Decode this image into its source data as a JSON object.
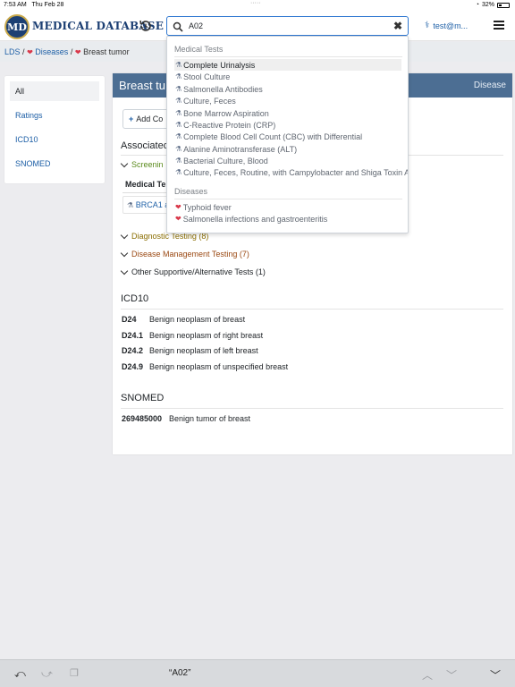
{
  "status": {
    "time": "7:53 AM",
    "date": "Thu Feb 28",
    "battery": "32%"
  },
  "brand": {
    "logo_letters": "MD",
    "name": "MEDICAL DATABASE"
  },
  "search": {
    "value": "A02"
  },
  "user": {
    "label": "test@m..."
  },
  "breadcrumb": {
    "root": "LDS",
    "sep1": "/",
    "diseases": "Diseases",
    "sep2": "/",
    "current": "Breast tumor"
  },
  "sidebar": {
    "items": [
      {
        "label": "All"
      },
      {
        "label": "Ratings"
      },
      {
        "label": "ICD10"
      },
      {
        "label": "SNOMED"
      }
    ]
  },
  "main": {
    "title": "Breast tu",
    "kind": "Disease",
    "add_button": "Add Co",
    "associated_title": "Associated",
    "screening_label": "Screenin",
    "medical_tests_header": "Medical Te",
    "brca_link": "BRCA1 a",
    "accordions": [
      {
        "label": "Diagnostic Testing (8)",
        "color": "#8a6d00"
      },
      {
        "label": "Disease Management Testing (7)",
        "color": "#9b4a14"
      },
      {
        "label": "Other Supportive/Alternative Tests (1)",
        "color": "#212529"
      }
    ],
    "icd10": {
      "title": "ICD10",
      "rows": [
        {
          "code": "D24",
          "desc": "Benign neoplasm of breast"
        },
        {
          "code": "D24.1",
          "desc": "Benign neoplasm of right breast"
        },
        {
          "code": "D24.2",
          "desc": "Benign neoplasm of left breast"
        },
        {
          "code": "D24.9",
          "desc": "Benign neoplasm of unspecified breast"
        }
      ]
    },
    "snomed": {
      "title": "SNOMED",
      "rows": [
        {
          "code": "269485000",
          "desc": "Benign tumor of breast"
        }
      ]
    }
  },
  "dropdown": {
    "tests_heading": "Medical Tests",
    "tests": [
      "Complete Urinalysis",
      "Stool Culture",
      "Salmonella Antibodies",
      "Culture, Feces",
      "Bone Marrow Aspiration",
      "C-Reactive Protein (CRP)",
      "Complete Blood Cell Count (CBC) with Differential",
      "Alanine Aminotransferase (ALT)",
      "Bacterial Culture, Blood",
      "Culture, Feces, Routine, with Campylobacter and Shiga Toxin An"
    ],
    "diseases_heading": "Diseases",
    "diseases": [
      "Typhoid fever",
      "Salmonella infections and gastroenteritis"
    ]
  },
  "keyboard": {
    "suggestion": "“A02”"
  },
  "colors": {
    "navy": "#1c3f73",
    "accent": "#1d5fa6",
    "header": "#4c6e93",
    "heart": "#d9384a"
  }
}
